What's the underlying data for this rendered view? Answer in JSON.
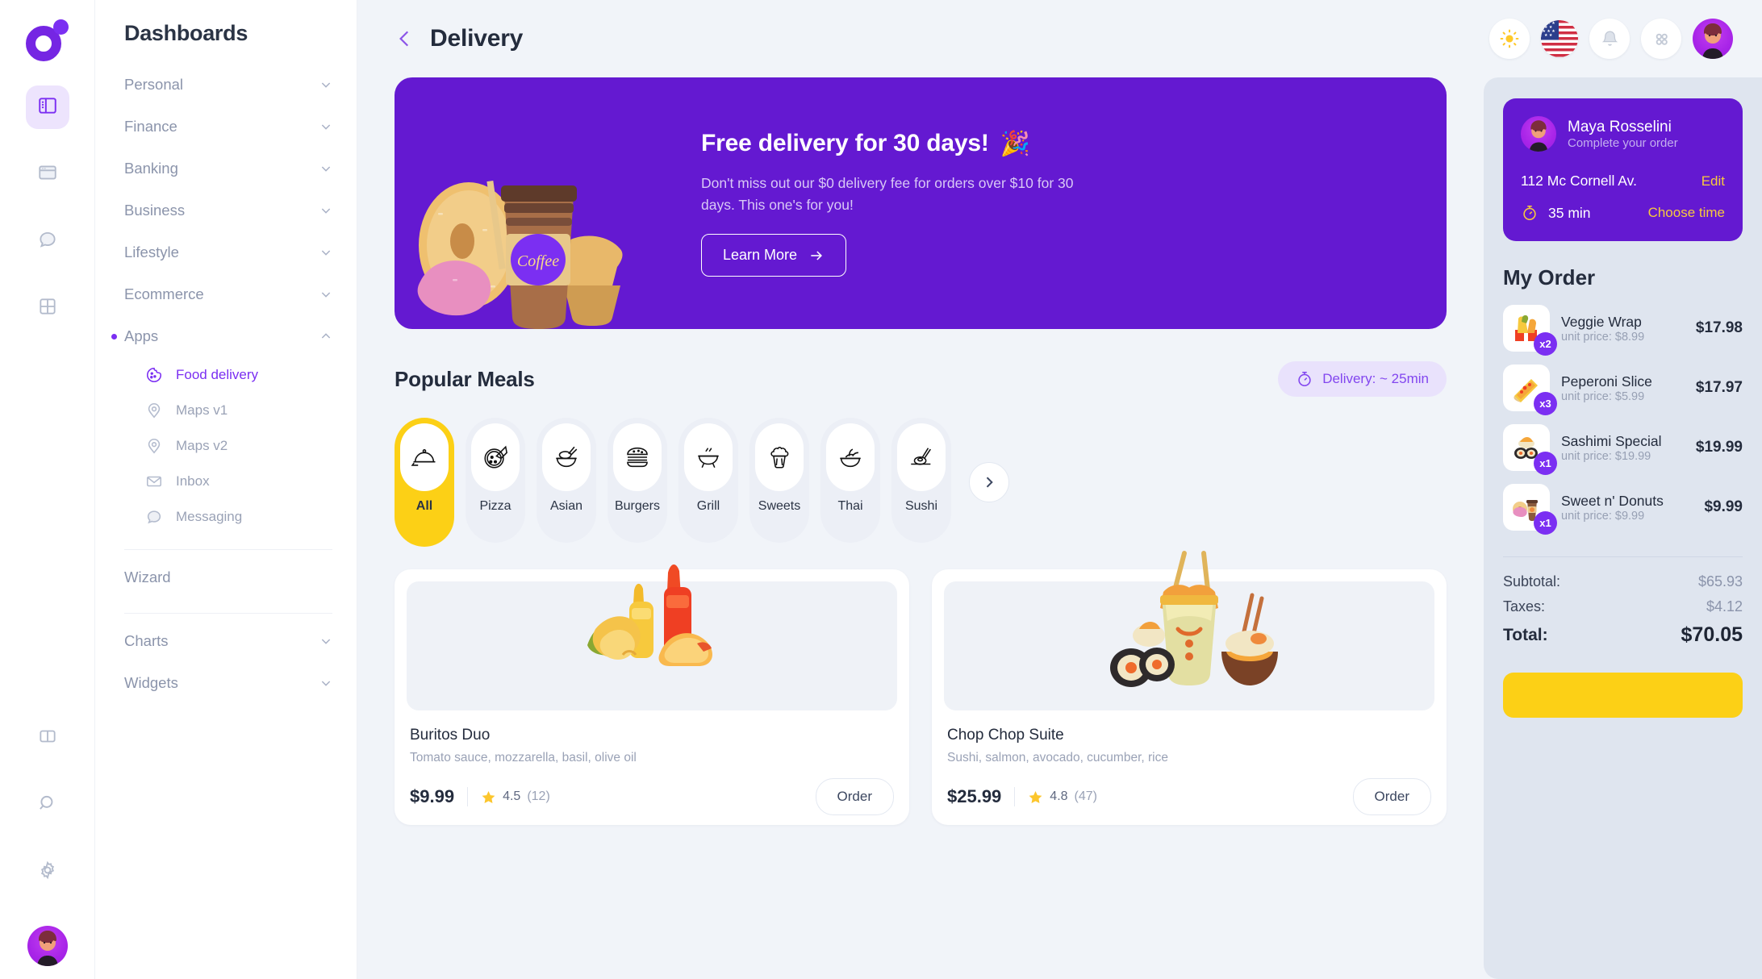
{
  "brand": {
    "accent": "#7b2ff2",
    "yellow": "#fcd016",
    "purple_deep": "#6419d1"
  },
  "rail": {
    "logo_name": "app-logo",
    "items": [
      {
        "icon": "dashboard-panel-icon",
        "active": true
      },
      {
        "icon": "window-icon",
        "active": false
      },
      {
        "icon": "chat-bubble-icon",
        "active": false
      },
      {
        "icon": "grid-icon",
        "active": false
      },
      {
        "icon": "split-panel-icon",
        "active": false
      },
      {
        "icon": "search-icon",
        "active": false
      },
      {
        "icon": "gear-icon",
        "active": false
      }
    ]
  },
  "nav": {
    "title": "Dashboards",
    "groups": [
      {
        "label": "Personal",
        "expanded": false
      },
      {
        "label": "Finance",
        "expanded": false
      },
      {
        "label": "Banking",
        "expanded": false
      },
      {
        "label": "Business",
        "expanded": false
      },
      {
        "label": "Lifestyle",
        "expanded": false
      },
      {
        "label": "Ecommerce",
        "expanded": false
      },
      {
        "label": "Apps",
        "expanded": true
      }
    ],
    "apps": [
      {
        "label": "Food delivery",
        "icon": "cookie-icon",
        "active": true
      },
      {
        "label": "Maps v1",
        "icon": "map-pin-icon",
        "active": false
      },
      {
        "label": "Maps v2",
        "icon": "map-pin-icon",
        "active": false
      },
      {
        "label": "Inbox",
        "icon": "envelope-icon",
        "active": false
      },
      {
        "label": "Messaging",
        "icon": "chat-bubble-icon",
        "active": false
      }
    ],
    "wizard": "Wizard",
    "tail_groups": [
      {
        "label": "Charts",
        "expanded": false
      },
      {
        "label": "Widgets",
        "expanded": false
      }
    ]
  },
  "header": {
    "back_icon": "chevron-left-icon",
    "title": "Delivery",
    "actions": [
      {
        "name": "theme-toggle-button",
        "icon": "sun-icon"
      },
      {
        "name": "language-button",
        "icon": "us-flag-icon"
      },
      {
        "name": "notifications-button",
        "icon": "bell-icon"
      },
      {
        "name": "apps-grid-button",
        "icon": "apps-dots-icon"
      },
      {
        "name": "profile-avatar",
        "icon": "avatar-icon"
      }
    ]
  },
  "banner": {
    "heading": "Free delivery for 30 days!",
    "heading_emoji": "🎉",
    "paragraph": "Don't miss out our $0 delivery fee for orders over $10 for 30 days. This one's for you!",
    "button_label": "Learn More",
    "button_icon": "arrow-right-icon",
    "art": "donut-coffee-muffin-illustration"
  },
  "popular": {
    "title": "Popular Meals",
    "delivery_pill": "Delivery: ~ 25min",
    "delivery_pill_icon": "stopwatch-icon",
    "next_icon": "chevron-right-icon",
    "categories": [
      {
        "label": "All",
        "icon": "cloche-icon",
        "active": true
      },
      {
        "label": "Pizza",
        "icon": "pizza-icon",
        "active": false
      },
      {
        "label": "Asian",
        "icon": "noodle-bowl-icon",
        "active": false
      },
      {
        "label": "Burgers",
        "icon": "burger-icon",
        "active": false
      },
      {
        "label": "Grill",
        "icon": "grill-icon",
        "active": false
      },
      {
        "label": "Sweets",
        "icon": "cupcake-icon",
        "active": false
      },
      {
        "label": "Thai",
        "icon": "thai-bowl-icon",
        "active": false
      },
      {
        "label": "Sushi",
        "icon": "sushi-icon",
        "active": false
      }
    ]
  },
  "meals": [
    {
      "name": "Buritos Duo",
      "desc": "Tomato sauce, mozzarella, basil, olive oil",
      "price": "$9.99",
      "rating": "4.5",
      "reviews": "(12)",
      "order_label": "Order",
      "image": "burritos-illustration"
    },
    {
      "name": "Chop Chop Suite",
      "desc": "Sushi, salmon, avocado, cucumber, rice",
      "price": "$25.99",
      "rating": "4.8",
      "reviews": "(47)",
      "order_label": "Order",
      "image": "asian-takeout-illustration"
    }
  ],
  "right": {
    "user": {
      "name": "Maya Rosselini",
      "subtitle": "Complete your order",
      "address": "112 Mc Cornell Av.",
      "edit_label": "Edit",
      "time": "35 min",
      "time_icon": "stopwatch-icon",
      "choose_time_label": "Choose time"
    },
    "order_title": "My Order",
    "items": [
      {
        "name": "Veggie Wrap",
        "unit": "unit price: $8.99",
        "qty": "x2",
        "total": "$17.98",
        "image": "veggie-wrap-icon"
      },
      {
        "name": "Peperoni Slice",
        "unit": "unit price: $5.99",
        "qty": "x3",
        "total": "$17.97",
        "image": "pizza-slice-icon"
      },
      {
        "name": "Sashimi Special",
        "unit": "unit price: $19.99",
        "qty": "x1",
        "total": "$19.99",
        "image": "sushi-roll-icon"
      },
      {
        "name": "Sweet n' Donuts",
        "unit": "unit price: $9.99",
        "qty": "x1",
        "total": "$9.99",
        "image": "donut-coffee-icon"
      }
    ],
    "totals": [
      {
        "label": "Subtotal:",
        "value": "$65.93",
        "grand": false
      },
      {
        "label": "Taxes:",
        "value": "$4.12",
        "grand": false
      },
      {
        "label": "Total:",
        "value": "$70.05",
        "grand": true
      }
    ],
    "checkout_label": ""
  }
}
